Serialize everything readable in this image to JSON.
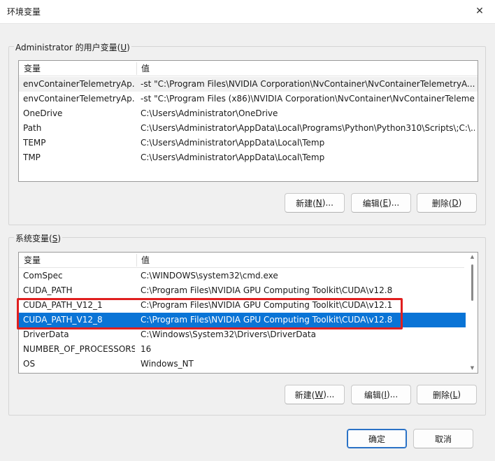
{
  "window": {
    "title": "环境变量",
    "close_glyph": "✕"
  },
  "user_section": {
    "legend_prefix": "Administrator 的用户变量(",
    "legend_key": "U",
    "legend_suffix": ")",
    "columns": [
      "变量",
      "值"
    ],
    "rows": [
      {
        "name": "envContainerTelemetryAp...",
        "value": "-st \"C:\\Program Files\\NVIDIA Corporation\\NvContainer\\NvContainerTelemetryA..."
      },
      {
        "name": "envContainerTelemetryAp...",
        "value": "-st \"C:\\Program Files (x86)\\NVIDIA Corporation\\NvContainer\\NvContainerTeleme..."
      },
      {
        "name": "OneDrive",
        "value": "C:\\Users\\Administrator\\OneDrive"
      },
      {
        "name": "Path",
        "value": "C:\\Users\\Administrator\\AppData\\Local\\Programs\\Python\\Python310\\Scripts\\;C:\\..."
      },
      {
        "name": "TEMP",
        "value": "C:\\Users\\Administrator\\AppData\\Local\\Temp"
      },
      {
        "name": "TMP",
        "value": "C:\\Users\\Administrator\\AppData\\Local\\Temp"
      }
    ],
    "buttons": {
      "new": {
        "label": "新建(",
        "key": "N",
        "suffix": ")..."
      },
      "edit": {
        "label": "编辑(",
        "key": "E",
        "suffix": ")..."
      },
      "delete": {
        "label": "删除(",
        "key": "D",
        "suffix": ")"
      }
    }
  },
  "system_section": {
    "legend_prefix": "系统变量(",
    "legend_key": "S",
    "legend_suffix": ")",
    "columns": [
      "变量",
      "值"
    ],
    "rows": [
      {
        "name": "ComSpec",
        "value": "C:\\WINDOWS\\system32\\cmd.exe"
      },
      {
        "name": "CUDA_PATH",
        "value": "C:\\Program Files\\NVIDIA GPU Computing Toolkit\\CUDA\\v12.8"
      },
      {
        "name": "CUDA_PATH_V12_1",
        "value": "C:\\Program Files\\NVIDIA GPU Computing Toolkit\\CUDA\\v12.1"
      },
      {
        "name": "CUDA_PATH_V12_8",
        "value": "C:\\Program Files\\NVIDIA GPU Computing Toolkit\\CUDA\\v12.8"
      },
      {
        "name": "DriverData",
        "value": "C:\\Windows\\System32\\Drivers\\DriverData"
      },
      {
        "name": "NUMBER_OF_PROCESSORS",
        "value": "16"
      },
      {
        "name": "OS",
        "value": "Windows_NT"
      }
    ],
    "selected_row": "CUDA_PATH_V12_8",
    "highlighted_rows": [
      "CUDA_PATH_V12_1",
      "CUDA_PATH_V12_8"
    ],
    "buttons": {
      "new": {
        "label": "新建(",
        "key": "W",
        "suffix": ")..."
      },
      "edit": {
        "label": "编辑(",
        "key": "I",
        "suffix": ")..."
      },
      "delete": {
        "label": "删除(",
        "key": "L",
        "suffix": ")"
      }
    }
  },
  "footer": {
    "ok_label": "确定",
    "cancel_label": "取消"
  },
  "colors": {
    "selection": "#0a74d6",
    "highlight_box": "#e01f1f",
    "primary_border": "#2a72c6"
  }
}
